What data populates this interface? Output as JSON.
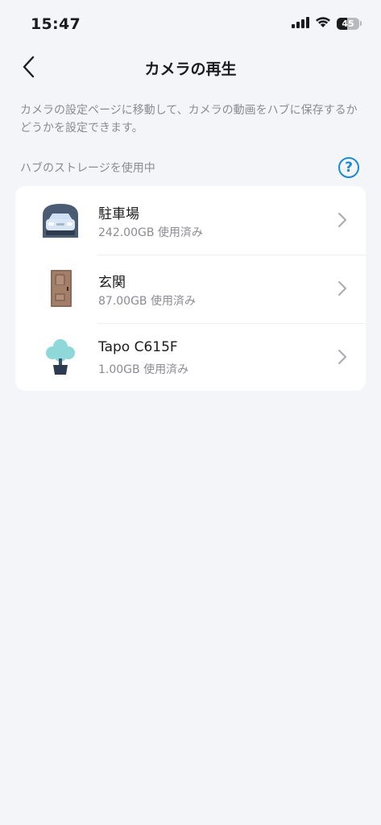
{
  "status_bar": {
    "time": "15:47",
    "battery_level": "45"
  },
  "nav": {
    "title": "カメラの再生"
  },
  "description": "カメラの設定ページに移動して、カメラの動画をハブに保存するかどうかを設定できます。",
  "section": {
    "label": "ハブのストレージを使用中",
    "help_symbol": "?"
  },
  "cameras": [
    {
      "name": "駐車場",
      "usage": "242.00GB 使用済み",
      "icon": "car-icon"
    },
    {
      "name": "玄関",
      "usage": "87.00GB 使用済み",
      "icon": "door-icon"
    },
    {
      "name": "Tapo C615F",
      "usage": "1.00GB 使用済み",
      "icon": "tree-icon"
    }
  ],
  "colors": {
    "accent": "#1a8ad6",
    "background": "#f4f5f9",
    "card": "#ffffff",
    "secondary_text": "#8b8b93"
  }
}
